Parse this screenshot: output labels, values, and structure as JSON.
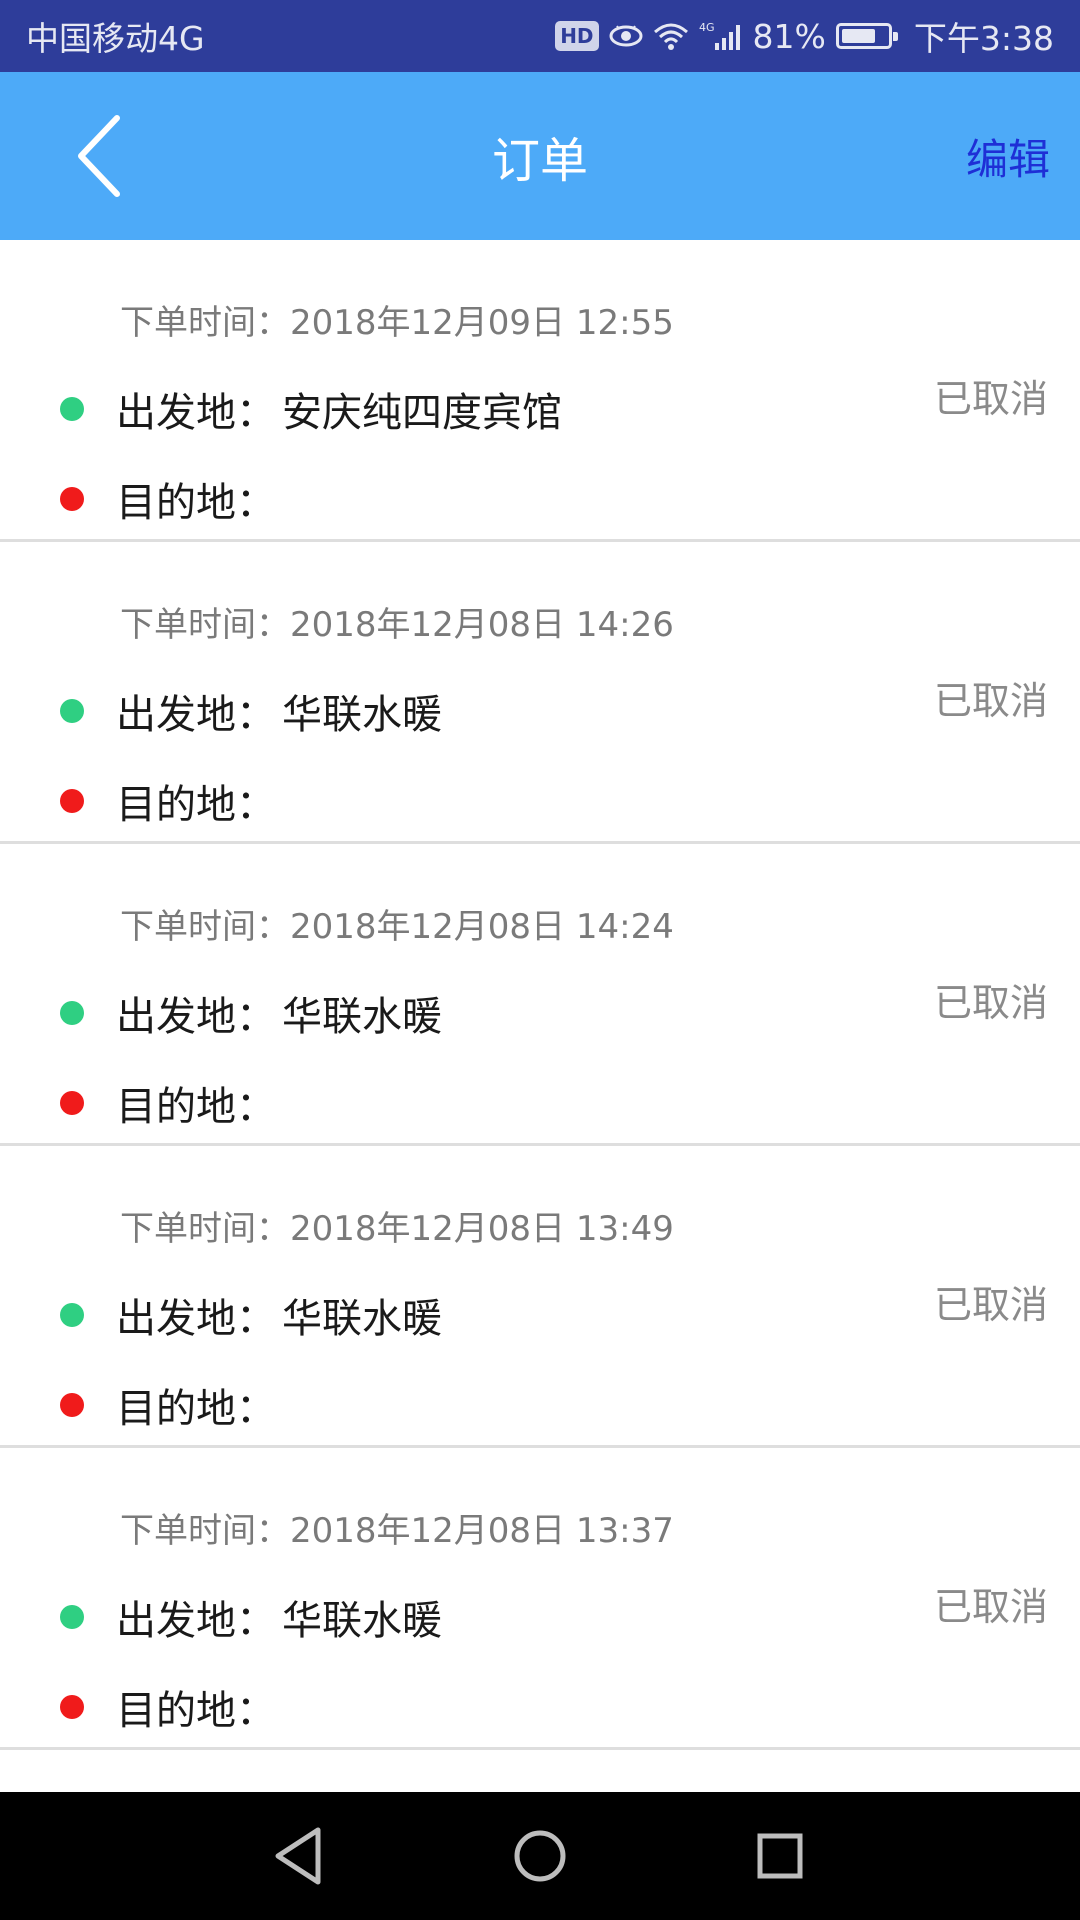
{
  "status_bar": {
    "carrier": "中国移动4G",
    "hd_badge": "HD",
    "network_badge": "4G",
    "battery_percent": "81%",
    "battery_level": 0.81,
    "time": "下午3:38"
  },
  "header": {
    "title": "订单",
    "edit_label": "编辑",
    "background_color": "#4daaf8"
  },
  "labels": {
    "time_prefix": "下单时间：",
    "start_prefix": "出发地：",
    "dest_prefix": "目的地："
  },
  "orders": [
    {
      "time": "2018年12月09日  12:55",
      "start": "安庆纯四度宾馆",
      "destination": "",
      "status": "已取消"
    },
    {
      "time": "2018年12月08日  14:26",
      "start": "华联水暖",
      "destination": "",
      "status": "已取消"
    },
    {
      "time": "2018年12月08日  14:24",
      "start": "华联水暖",
      "destination": "",
      "status": "已取消"
    },
    {
      "time": "2018年12月08日  13:49",
      "start": "华联水暖",
      "destination": "",
      "status": "已取消"
    },
    {
      "time": "2018年12月08日  13:37",
      "start": "华联水暖",
      "destination": "",
      "status": "已取消"
    }
  ],
  "colors": {
    "start_dot": "#2fcf82",
    "dest_dot": "#f01b1b",
    "edit_text": "#1e2fd6",
    "status_bar": "#2e3d9a"
  },
  "icons": {
    "back": "chevron-left-icon",
    "nav_back": "triangle-back-icon",
    "nav_home": "circle-home-icon",
    "nav_recent": "square-recent-icon"
  }
}
